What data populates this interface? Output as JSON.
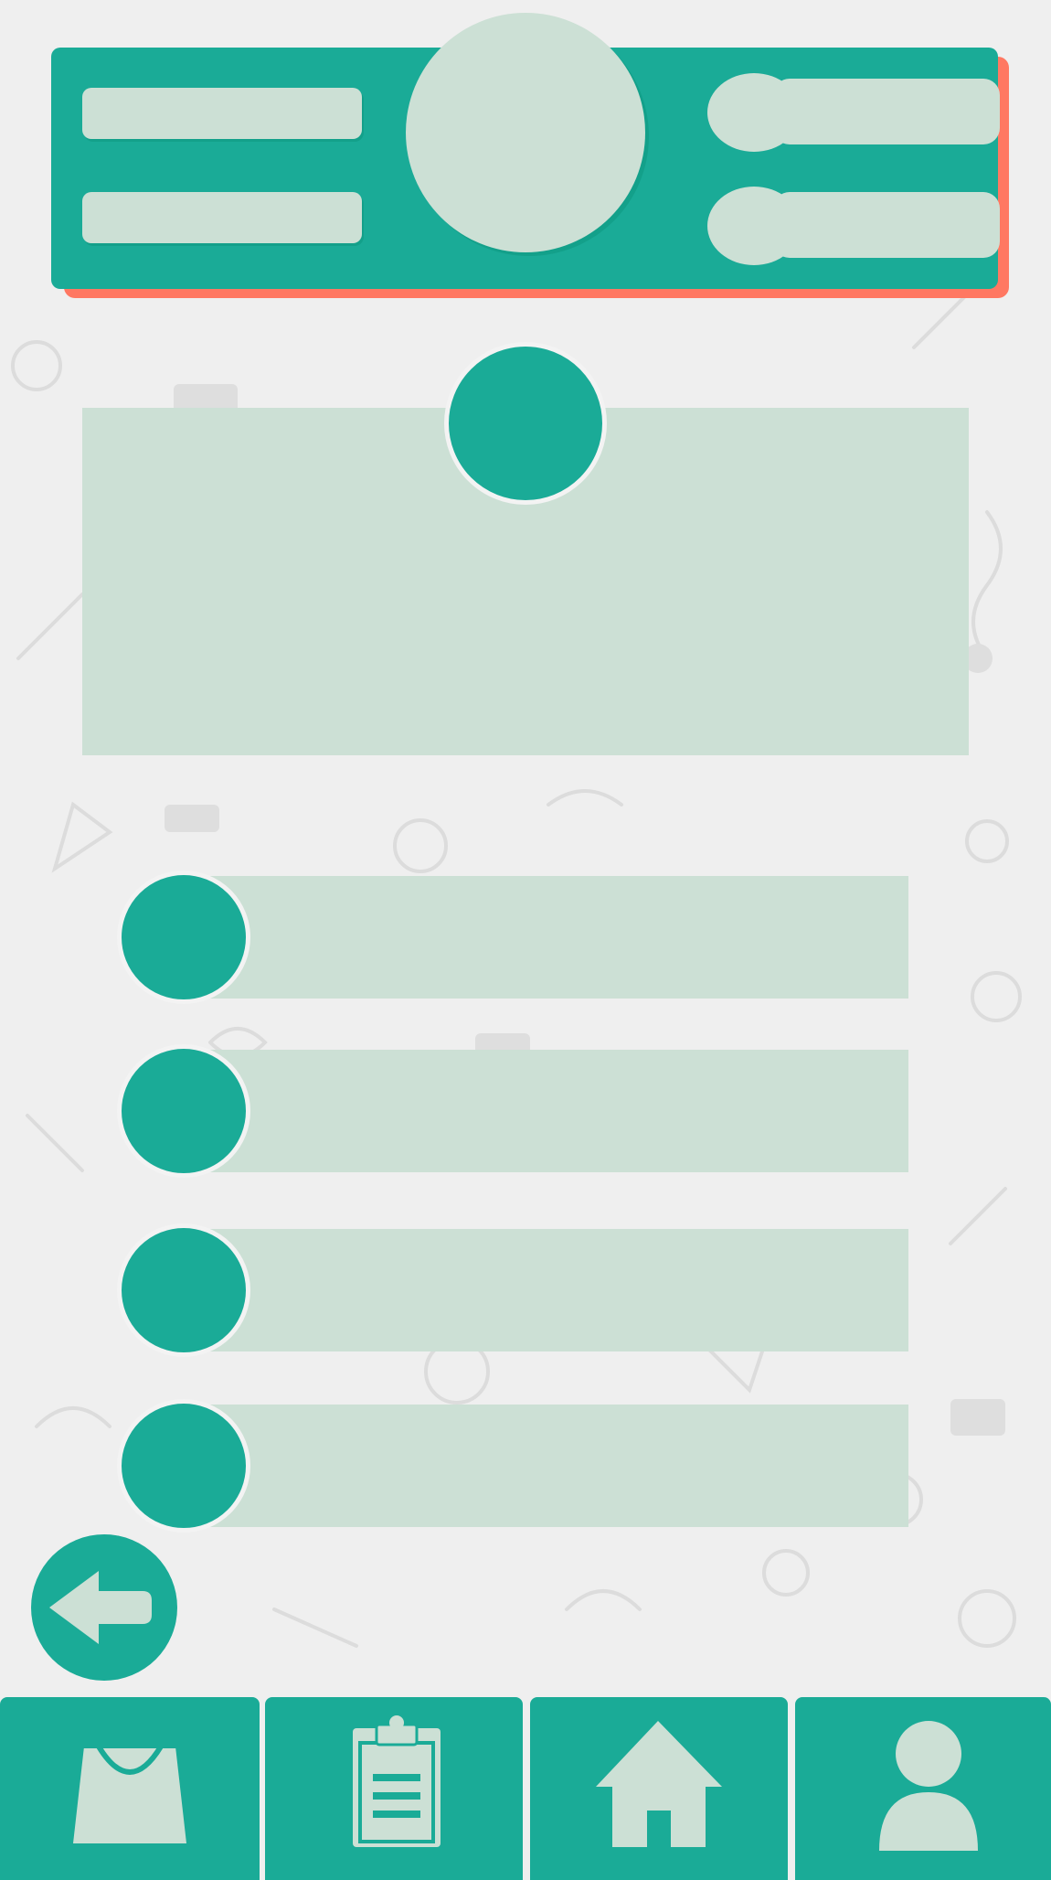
{
  "colors": {
    "primary": "#1aab97",
    "pale": "#cce0d5",
    "accent": "#ff7862",
    "background": "#efefef"
  },
  "header": {
    "left_fields": [
      "",
      ""
    ],
    "right_options": [
      "",
      ""
    ],
    "avatar_icon": "profile-circle"
  },
  "main_card": {
    "badge_icon": "circle-badge",
    "content": ""
  },
  "list_items": [
    {
      "label": ""
    },
    {
      "label": ""
    },
    {
      "label": ""
    },
    {
      "label": ""
    }
  ],
  "back_button": {
    "icon": "back-arrow-icon"
  },
  "bottom_nav": [
    {
      "icon": "shopping-bag-icon"
    },
    {
      "icon": "clipboard-icon"
    },
    {
      "icon": "home-icon"
    },
    {
      "icon": "user-icon"
    }
  ]
}
